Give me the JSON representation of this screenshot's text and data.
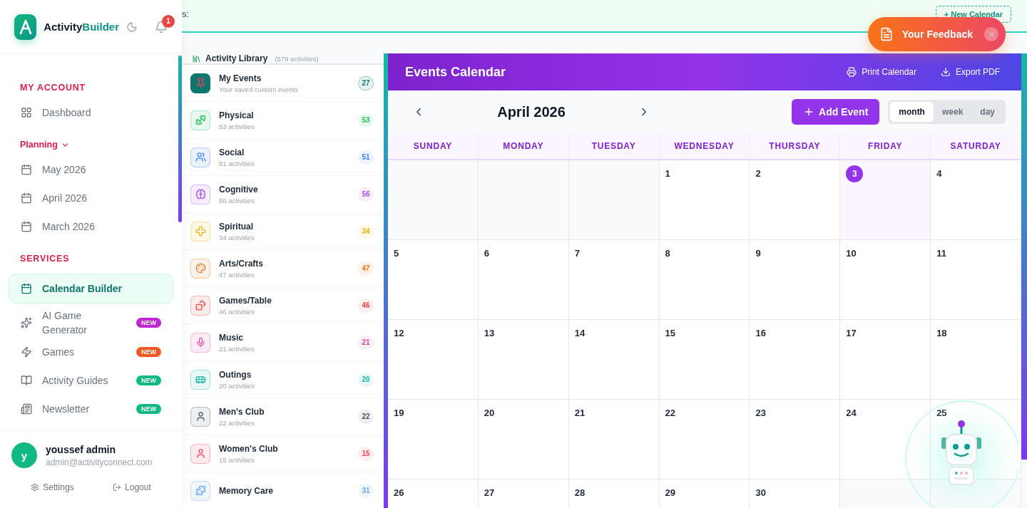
{
  "sidebar": {
    "brand_first": "Activity",
    "brand_second": "Builder",
    "notifications": "1",
    "nav": [
      {
        "kind": "heading",
        "label": "MY ACCOUNT"
      },
      {
        "kind": "item",
        "label": "Dashboard",
        "selected": false
      },
      {
        "kind": "group",
        "label": "Planning",
        "expanded": true
      },
      {
        "kind": "item",
        "label": "May 2026",
        "selected": false
      },
      {
        "kind": "item",
        "label": "April 2026",
        "selected": false
      },
      {
        "kind": "item",
        "label": "March 2026",
        "selected": false
      },
      {
        "kind": "heading",
        "label": "SERVICES"
      },
      {
        "kind": "item",
        "label": "Calendar Builder",
        "selected": true
      },
      {
        "kind": "item",
        "label": "AI Game Generator",
        "selected": false,
        "badge": "NEW",
        "color": "#c026d3"
      },
      {
        "kind": "item",
        "label": "Games",
        "selected": false,
        "badge": "NEW",
        "color": "#f05a22"
      },
      {
        "kind": "item",
        "label": "Activity Guides",
        "selected": false,
        "badge": "NEW",
        "color": "#10b981"
      },
      {
        "kind": "item",
        "label": "Newsletter",
        "selected": false,
        "badge": "NEW",
        "color": "#10b981"
      }
    ],
    "user": {
      "avatar": "y",
      "name": "youssef admin",
      "email": "admin@activityconnect.com"
    },
    "actions": [
      "Settings",
      "Logout"
    ]
  },
  "banner": {
    "text": "s:",
    "button": "+ New Calendar"
  },
  "feedback": {
    "label": "Your Feedback"
  },
  "library": {
    "title": "Activity Library",
    "count": "(579 activities)",
    "categories": [
      {
        "name": "My Events",
        "sub": "Your saved custom events",
        "count": "27",
        "color": "#0f766e"
      },
      {
        "name": "Physical",
        "sub": "53 activities",
        "count": "53",
        "color": "#22c55e"
      },
      {
        "name": "Social",
        "sub": "51 activities",
        "count": "51",
        "color": "#3b82f6"
      },
      {
        "name": "Cognitive",
        "sub": "56 activities",
        "count": "56",
        "color": "#a855f7"
      },
      {
        "name": "Spiritual",
        "sub": "34 activities",
        "count": "34",
        "color": "#eab308"
      },
      {
        "name": "Arts/Crafts",
        "sub": "47 activities",
        "count": "47",
        "color": "#f97316"
      },
      {
        "name": "Games/Table",
        "sub": "46 activities",
        "count": "46",
        "color": "#ef4444"
      },
      {
        "name": "Music",
        "sub": "21 activities",
        "count": "21",
        "color": "#ec4899"
      },
      {
        "name": "Outings",
        "sub": "20 activities",
        "count": "20",
        "color": "#14b8a6"
      },
      {
        "name": "Men's Club",
        "sub": "22 activities",
        "count": "22",
        "color": "#4b5563"
      },
      {
        "name": "Women's Club",
        "sub": "15 activities",
        "count": "15",
        "color": "#f43f5e"
      },
      {
        "name": "Memory Care",
        "count": "31",
        "color": "#60a5fa"
      }
    ]
  },
  "calendar": {
    "title": "Events Calendar",
    "actions": [
      "Print Calendar",
      "Export PDF"
    ],
    "month": "April 2026",
    "add": "Add Event",
    "views": [
      {
        "label": "month",
        "selected": true
      },
      {
        "label": "week",
        "selected": false
      },
      {
        "label": "day",
        "selected": false
      }
    ],
    "weekdays": [
      "SUNDAY",
      "MONDAY",
      "TUESDAY",
      "WEDNESDAY",
      "THURSDAY",
      "FRIDAY",
      "SATURDAY"
    ],
    "weeks": [
      [
        {
          "kind": "blank"
        },
        {
          "kind": "blank"
        },
        {
          "kind": "blank"
        },
        {
          "kind": "day",
          "day": "1",
          "today": false
        },
        {
          "kind": "day",
          "day": "2",
          "today": false
        },
        {
          "kind": "day",
          "day": "3",
          "today": true
        },
        {
          "kind": "day",
          "day": "4",
          "today": false
        }
      ],
      [
        {
          "kind": "day",
          "day": "5",
          "today": false
        },
        {
          "kind": "day",
          "day": "6",
          "today": false
        },
        {
          "kind": "day",
          "day": "7",
          "today": false
        },
        {
          "kind": "day",
          "day": "8",
          "today": false
        },
        {
          "kind": "day",
          "day": "9",
          "today": false
        },
        {
          "kind": "day",
          "day": "10",
          "today": false
        },
        {
          "kind": "day",
          "day": "11",
          "today": false
        }
      ],
      [
        {
          "kind": "day",
          "day": "12",
          "today": false
        },
        {
          "kind": "day",
          "day": "13",
          "today": false
        },
        {
          "kind": "day",
          "day": "14",
          "today": false
        },
        {
          "kind": "day",
          "day": "15",
          "today": false
        },
        {
          "kind": "day",
          "day": "16",
          "today": false
        },
        {
          "kind": "day",
          "day": "17",
          "today": false
        },
        {
          "kind": "day",
          "day": "18",
          "today": false
        }
      ],
      [
        {
          "kind": "day",
          "day": "19",
          "today": false
        },
        {
          "kind": "day",
          "day": "20",
          "today": false
        },
        {
          "kind": "day",
          "day": "21",
          "today": false
        },
        {
          "kind": "day",
          "day": "22",
          "today": false
        },
        {
          "kind": "day",
          "day": "23",
          "today": false
        },
        {
          "kind": "day",
          "day": "24",
          "today": false
        },
        {
          "kind": "day",
          "day": "25",
          "today": false
        }
      ],
      [
        {
          "kind": "day",
          "day": "26",
          "today": false
        },
        {
          "kind": "day",
          "day": "27",
          "today": false
        },
        {
          "kind": "day",
          "day": "28",
          "today": false
        },
        {
          "kind": "day",
          "day": "29",
          "today": false
        },
        {
          "kind": "day",
          "day": "30",
          "today": false
        },
        {
          "kind": "blank"
        },
        {
          "kind": "blank"
        }
      ]
    ]
  }
}
